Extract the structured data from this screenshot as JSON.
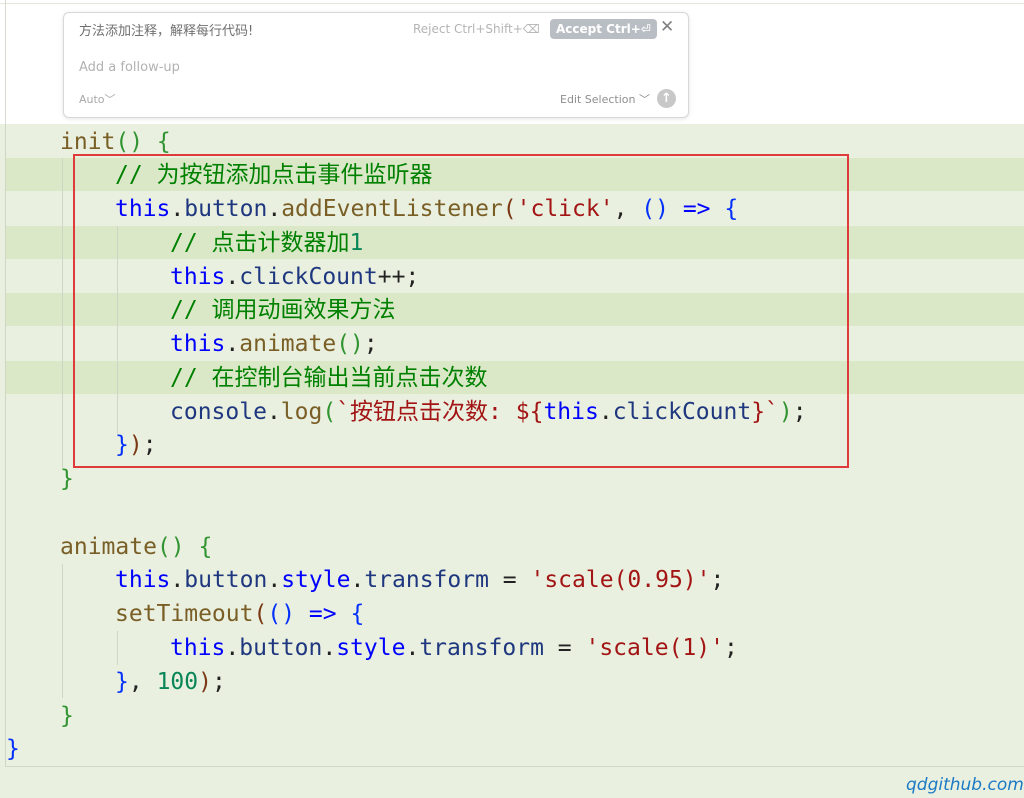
{
  "popup": {
    "prompt": "方法添加注释，解释每行代码!",
    "reject_label": "Reject Ctrl+Shift+⌫",
    "accept_label": "Accept Ctrl+⏎",
    "close_glyph": "✕",
    "followup_placeholder": "Add a follow-up",
    "mode_label": "Auto",
    "mode_chevron": "﹀",
    "edit_selection_label": "Edit Selection",
    "edit_selection_chevron": "﹀",
    "submit_glyph": "↑"
  },
  "code": {
    "l1": {
      "name": "init",
      "open": "() {"
    },
    "l2": {
      "comment": "// 为按钮添加点击事件监听器"
    },
    "l3": {
      "this": "this",
      "dot1": ".",
      "obj": "button",
      "dot2": ".",
      "method": "addEventListener",
      "p1": "(",
      "str": "'click'",
      "comma": ", ",
      "args": "()",
      "arrow": " => ",
      "brace": "{"
    },
    "l4": {
      "comment": "// 点击计数器加",
      "num": "1"
    },
    "l5": {
      "this": "this",
      "dot": ".",
      "prop": "clickCount",
      "rest": "++;"
    },
    "l6": {
      "comment": "// 调用动画效果方法"
    },
    "l7": {
      "this": "this",
      "dot": ".",
      "method": "animate",
      "parens": "()",
      "semi": ";"
    },
    "l8": {
      "comment": "// 在控制台输出当前点击次数"
    },
    "l9": {
      "obj": "console",
      "dot": ".",
      "method": "log",
      "p1": "(",
      "tpl_start": "`按钮点击次数: ${",
      "this": "this",
      "dot2": ".",
      "prop": "clickCount",
      "tpl_end": "}`",
      "p2": ")",
      "semi": ";"
    },
    "l10": {
      "close": "}",
      "paren": ")",
      "semi": ";"
    },
    "l11": {
      "close": "}"
    },
    "l13": {
      "name": "animate",
      "open": "() {"
    },
    "l14": {
      "this": "this",
      "dot1": ".",
      "obj": "button",
      "dot2": ".",
      "style": "style",
      "dot3": ".",
      "prop": "transform",
      "eq": " = ",
      "str": "'scale(0.95)'",
      "semi": ";"
    },
    "l15": {
      "fn": "setTimeout",
      "p1": "(",
      "args": "()",
      "arrow": " => ",
      "brace": "{"
    },
    "l16": {
      "this": "this",
      "dot1": ".",
      "obj": "button",
      "dot2": ".",
      "style": "style",
      "dot3": ".",
      "prop": "transform",
      "eq": " = ",
      "str": "'scale(1)'",
      "semi": ";"
    },
    "l17": {
      "close": "}",
      "comma": ", ",
      "num": "100",
      "paren": ")",
      "semi": ";"
    },
    "l18": {
      "close": "}"
    },
    "l19": {
      "close": "}"
    }
  },
  "watermark": "qdgithub.com",
  "colors": {
    "editor_bg": "#e9f0df",
    "highlight": "#dae8c8",
    "selection_box": "#e03b3b",
    "keyword": "#0000ff",
    "function": "#795e26",
    "string": "#a31515",
    "comment": "#008000",
    "number": "#098658",
    "watermark": "#1c7ac5"
  }
}
